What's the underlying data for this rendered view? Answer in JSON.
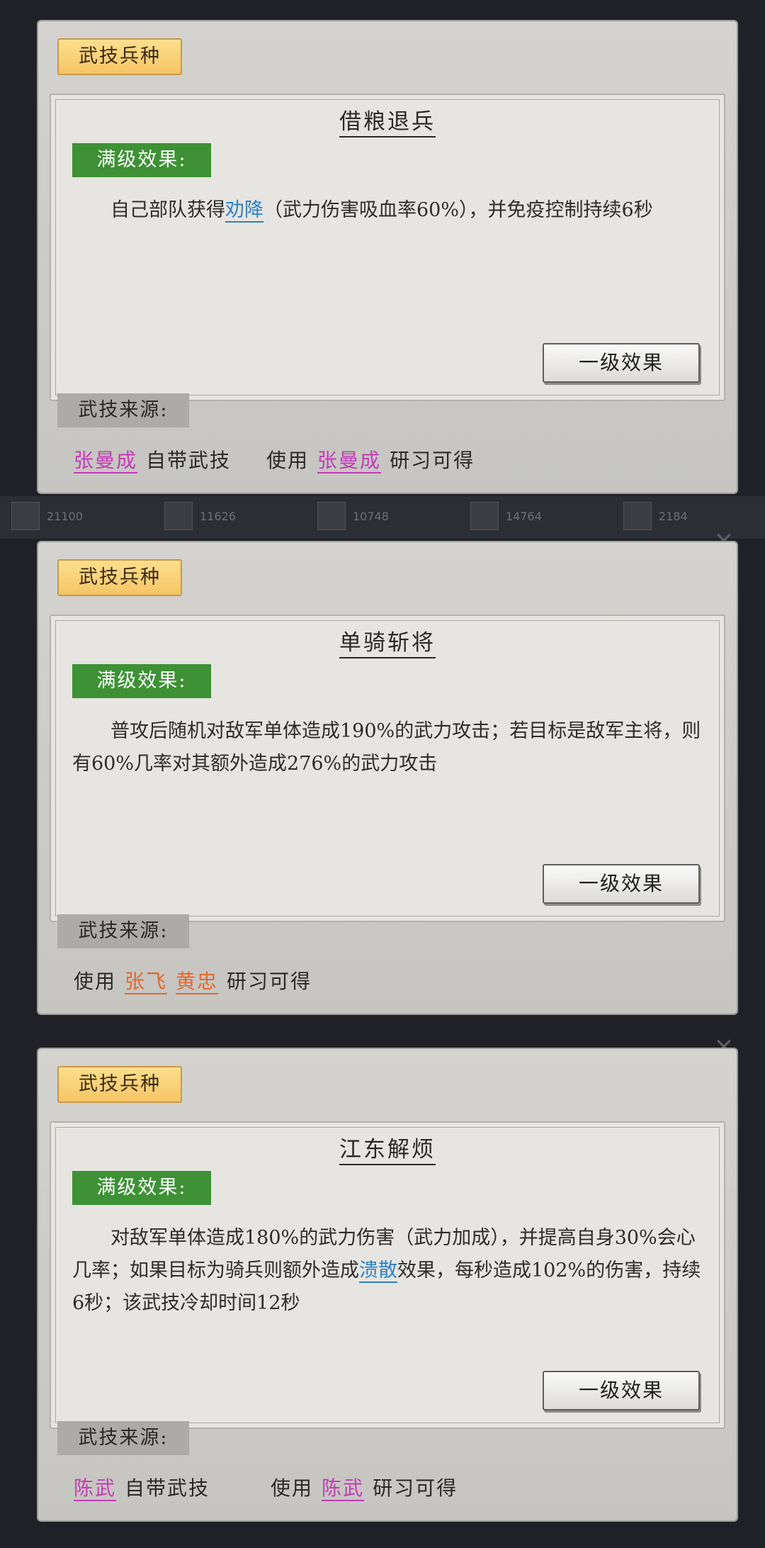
{
  "panels": [
    {
      "tag": "武技兵种",
      "title": "借粮退兵",
      "level_tag": "满级效果:",
      "desc_pre": "自己部队获得",
      "desc_hl": "劝降",
      "desc_post": "（武力伤害吸血率60%），并免疫控制持续6秒",
      "button": "一级效果",
      "source_tag": "武技来源:",
      "source": {
        "name1": "张曼成",
        "text1": "自带武技",
        "text2": "使用",
        "name2": "张曼成",
        "text3": "研习可得"
      }
    },
    {
      "tag": "武技兵种",
      "title": "单骑斩将",
      "level_tag": "满级效果:",
      "desc": "普攻后随机对敌军单体造成190%的武力攻击；若目标是敌军主将，则有60%几率对其额外造成276%的武力攻击",
      "button": "一级效果",
      "source_tag": "武技来源:",
      "source": {
        "text1": "使用",
        "name1": "张飞",
        "name2": "黄忠",
        "text2": "研习可得"
      }
    },
    {
      "tag": "武技兵种",
      "title": "江东解烦",
      "level_tag": "满级效果:",
      "desc_pre": "对敌军单体造成180%的武力伤害（武力加成），并提高自身30%会心几率；如果目标为骑兵则额外造成",
      "desc_hl": "溃散",
      "desc_post": "效果，每秒造成102%的伤害，持续6秒；该武技冷却时间12秒",
      "button": "一级效果",
      "source_tag": "武技来源:",
      "source": {
        "name1": "陈武",
        "text1": "自带武技",
        "text2": "使用",
        "name2": "陈武",
        "text3": "研习可得"
      }
    }
  ],
  "background": {
    "stats": [
      "21100",
      "11626",
      "10748",
      "14764",
      "2184"
    ],
    "close_icon": "close-icon"
  }
}
